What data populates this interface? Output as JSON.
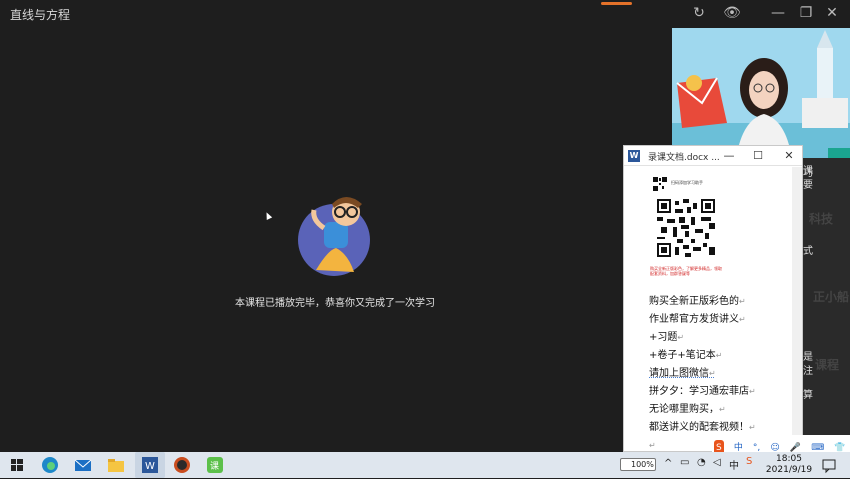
{
  "app": {
    "title": "直线与方程"
  },
  "player": {
    "end_message": "本课程已播放完毕，恭喜你又完成了一次学习",
    "buttons": {
      "refresh": "↻",
      "eye": "👁",
      "minimize": "—",
      "restore": "❐",
      "close": "✕"
    }
  },
  "side_panel": {
    "texts": [
      "课",
      "巧",
      "要",
      "科技",
      "式",
      "正小船",
      "是",
      "注",
      "算",
      "课程"
    ]
  },
  "word_window": {
    "title": "录课文档.docx ...",
    "buttons": {
      "minimize": "—",
      "maximize": "☐",
      "close": "✕"
    },
    "qr_caption": "扫码添加学习助手",
    "qr_red_text": "购买全新正版彩色，了解更多精品，领取配套资料，加群答疑等",
    "lines": [
      "购买全新正版彩色的",
      "作业帮官方发货讲义",
      "+习题",
      "+卷子+笔记本",
      "请加上图微信",
      "拼夕夕：学习通宏菲店",
      "无论哪里购买，",
      "都送讲义的配套视频！",
      ""
    ]
  },
  "ime": {
    "items": [
      "中",
      "°,",
      "☺",
      "🎤",
      "⌨",
      "👕",
      "⊞"
    ]
  },
  "taskbar": {
    "battery": "100%",
    "time": "18:05",
    "date": "2021/9/19"
  }
}
